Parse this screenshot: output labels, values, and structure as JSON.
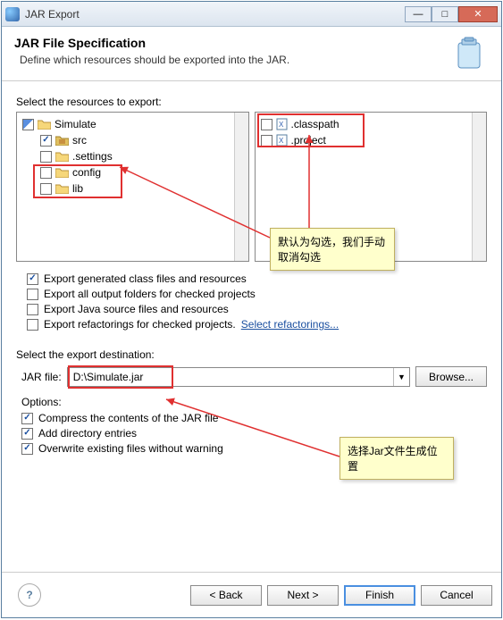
{
  "window": {
    "title": "JAR Export"
  },
  "header": {
    "title": "JAR File Specification",
    "subtitle": "Define which resources should be exported into the JAR."
  },
  "labels": {
    "select_resources": "Select the resources to export:",
    "select_dest": "Select the export destination:",
    "jar_file": "JAR file:",
    "options": "Options:"
  },
  "tree": {
    "root": "Simulate",
    "children": [
      "src",
      ".settings",
      "config",
      "lib"
    ]
  },
  "right_files": [
    ".classpath",
    ".project"
  ],
  "checkboxes": {
    "export_generated": "Export generated class files and resources",
    "export_all_output": "Export all output folders for checked projects",
    "export_java_source": "Export Java source files and resources",
    "export_refactorings": "Export refactorings for checked projects.",
    "refactorings_link": "Select refactorings..."
  },
  "dest": {
    "value": "D:\\Simulate.jar",
    "browse": "Browse..."
  },
  "options": {
    "compress": "Compress the contents of the JAR file",
    "add_dir": "Add directory entries",
    "overwrite": "Overwrite existing files without warning"
  },
  "buttons": {
    "back": "< Back",
    "next": "Next >",
    "finish": "Finish",
    "cancel": "Cancel"
  },
  "tooltips": {
    "t1": "默认为勾选，我们手动取消勾选",
    "t2": "选择Jar文件生成位置"
  }
}
